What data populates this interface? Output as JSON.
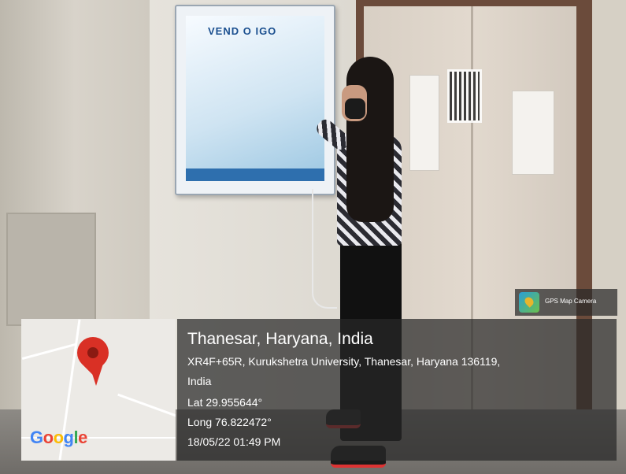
{
  "photo": {
    "machine_brand": "VEND O IGO"
  },
  "location": {
    "title": "Thanesar, Haryana, India",
    "address_line1": "XR4F+65R, Kurukshetra University, Thanesar, Haryana 136119,",
    "address_line2": "India",
    "latitude": "Lat 29.955644°",
    "longitude": "Long 76.822472°",
    "timestamp": "18/05/22 01:49 PM"
  },
  "map": {
    "logo": {
      "g1": "G",
      "o1": "o",
      "o2": "o",
      "g2": "g",
      "l": "l",
      "e": "e"
    },
    "pin_icon": "map-pin-icon",
    "pin_color": "#d93025"
  },
  "app_badge": {
    "label": "GPS Map Camera",
    "icon": "gps-map-camera-icon"
  },
  "colors": {
    "overlay": "#282828",
    "text": "#ffffff"
  }
}
